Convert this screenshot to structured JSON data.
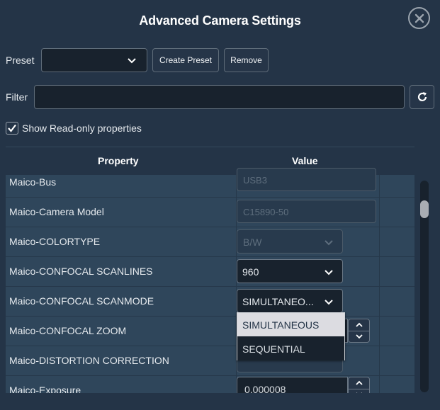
{
  "dialog": {
    "title": "Advanced Camera Settings",
    "close_icon": "close-circle-icon"
  },
  "preset": {
    "label": "Preset",
    "selected_value": "",
    "create_label": "Create Preset",
    "remove_label": "Remove"
  },
  "filter": {
    "label": "Filter",
    "value": "",
    "placeholder": "",
    "refresh_icon": "refresh-icon"
  },
  "show_readonly": {
    "label": "Show Read-only properties",
    "checked": true
  },
  "table": {
    "columns": [
      "Property",
      "Value"
    ],
    "rows": [
      {
        "name": "Maico-Bus",
        "type": "readonly-text",
        "value": "USB3"
      },
      {
        "name": "Maico-Camera Model",
        "type": "readonly-text",
        "value": "C15890-50"
      },
      {
        "name": "Maico-COLORTYPE",
        "type": "readonly-select",
        "value": "B/W"
      },
      {
        "name": "Maico-CONFOCAL SCANLINES",
        "type": "select",
        "value": "960"
      },
      {
        "name": "Maico-CONFOCAL SCANMODE",
        "type": "select",
        "value": "SIMULTANEO...",
        "open": true,
        "options": [
          "SIMULTANEOUS",
          "SEQUENTIAL"
        ],
        "highlighted_option": "SIMULTANEOUS"
      },
      {
        "name": "Maico-CONFOCAL ZOOM",
        "type": "number",
        "value": ""
      },
      {
        "name": "Maico-DISTORTION CORRECTION",
        "type": "select",
        "value": ""
      },
      {
        "name": "Maico-Exposure",
        "type": "number",
        "value": "0.000008"
      }
    ]
  },
  "scrollbar": {
    "position_fraction": 0.1
  }
}
